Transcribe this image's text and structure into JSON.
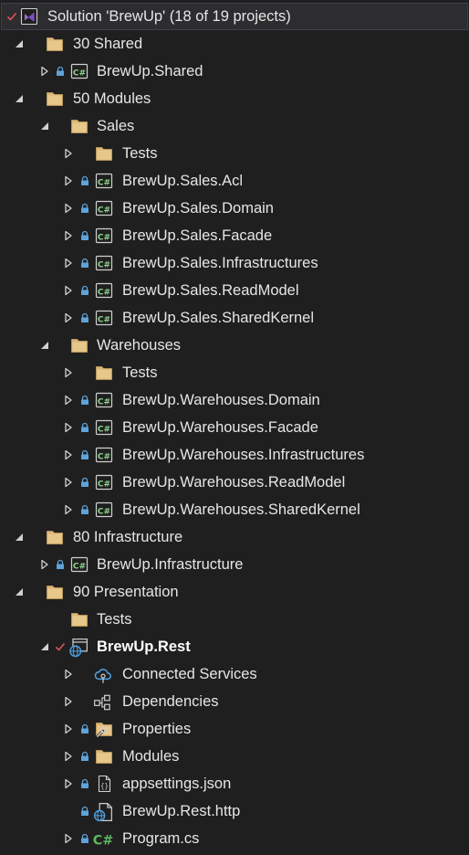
{
  "solution": {
    "title": "Solution 'BrewUp' (18 of 19 projects)"
  },
  "tree": {
    "shared_folder": "30 Shared",
    "shared_project": "BrewUp.Shared",
    "modules_folder": "50 Modules",
    "sales_folder": "Sales",
    "sales_tests": "Tests",
    "sales_acl": "BrewUp.Sales.Acl",
    "sales_domain": "BrewUp.Sales.Domain",
    "sales_facade": "BrewUp.Sales.Facade",
    "sales_infra": "BrewUp.Sales.Infrastructures",
    "sales_readmodel": "BrewUp.Sales.ReadModel",
    "sales_kernel": "BrewUp.Sales.SharedKernel",
    "warehouses_folder": "Warehouses",
    "warehouses_tests": "Tests",
    "warehouses_domain": "BrewUp.Warehouses.Domain",
    "warehouses_facade": "BrewUp.Warehouses.Facade",
    "warehouses_infra": "BrewUp.Warehouses.Infrastructures",
    "warehouses_readmodel": "BrewUp.Warehouses.ReadModel",
    "warehouses_kernel": "BrewUp.Warehouses.SharedKernel",
    "infrastructure_folder": "80 Infrastructure",
    "infrastructure_project": "BrewUp.Infrastructure",
    "presentation_folder": "90 Presentation",
    "presentation_tests": "Tests",
    "rest_project": "BrewUp.Rest",
    "connected_services": "Connected Services",
    "dependencies": "Dependencies",
    "properties": "Properties",
    "modules": "Modules",
    "appsettings": "appsettings.json",
    "rest_http": "BrewUp.Rest.http",
    "program": "Program.cs"
  },
  "colors": {
    "background": "#1f1f1f",
    "folder": "#dcb67a",
    "csharp_project": "#8dd28a",
    "csharp_file": "#5fb760",
    "lock": "#5ea3d9",
    "check": "#e0525b",
    "vs_purple": "#9b6bd6",
    "globe": "#4d9fe0"
  },
  "icons": [
    "visual-studio-solution-icon",
    "folder-icon",
    "csharp-project-icon",
    "lock-icon",
    "check-icon",
    "web-project-icon",
    "connected-services-icon",
    "dependencies-icon",
    "properties-icon",
    "json-file-icon",
    "http-file-icon",
    "csharp-file-icon"
  ]
}
